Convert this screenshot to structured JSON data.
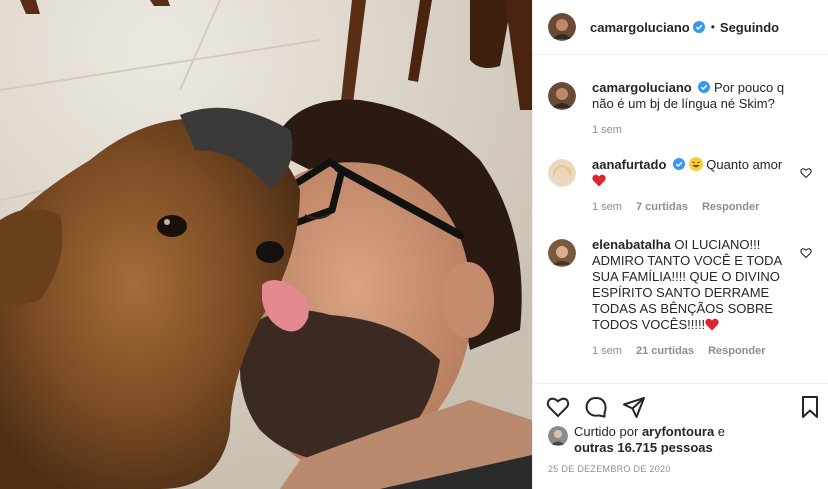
{
  "header": {
    "username": "camargoluciano",
    "separator": "•",
    "follow_status": "Seguindo"
  },
  "caption": {
    "username": "camargoluciano",
    "text": "Por pouco q não é um bj de língua né Skim?",
    "time": "1 sem"
  },
  "comments": [
    {
      "username": "aanafurtado",
      "text": "Quanto amor",
      "time": "1 sem",
      "likes": "7 curtidas",
      "reply": "Responder"
    },
    {
      "username": "elenabatalha",
      "text": "OI LUCIANO!!! ADMIRO TANTO VOCÊ E TODA SUA FAMÍLIA!!!! QUE O DIVINO ESPÍRITO SANTO DERRAME TODAS AS BÊNÇÃOS SOBRE TODOS VOCÊS!!!!!",
      "time": "1 sem",
      "likes": "21 curtidas",
      "reply": "Responder"
    }
  ],
  "likes": {
    "prefix": "Curtido por",
    "user": "aryfontoura",
    "conj": "e",
    "others": "outras 16.715 pessoas"
  },
  "date": "25 DE DEZEMBRO DE 2020",
  "icons": {
    "verified": "verified-badge-icon",
    "like": "heart-icon",
    "comment": "comment-icon",
    "share": "paper-plane-icon",
    "save": "bookmark-icon"
  },
  "colors": {
    "verified": "#3897f0",
    "heart_red": "#ed4956",
    "muted": "#8e8e8e",
    "text": "#262626"
  }
}
